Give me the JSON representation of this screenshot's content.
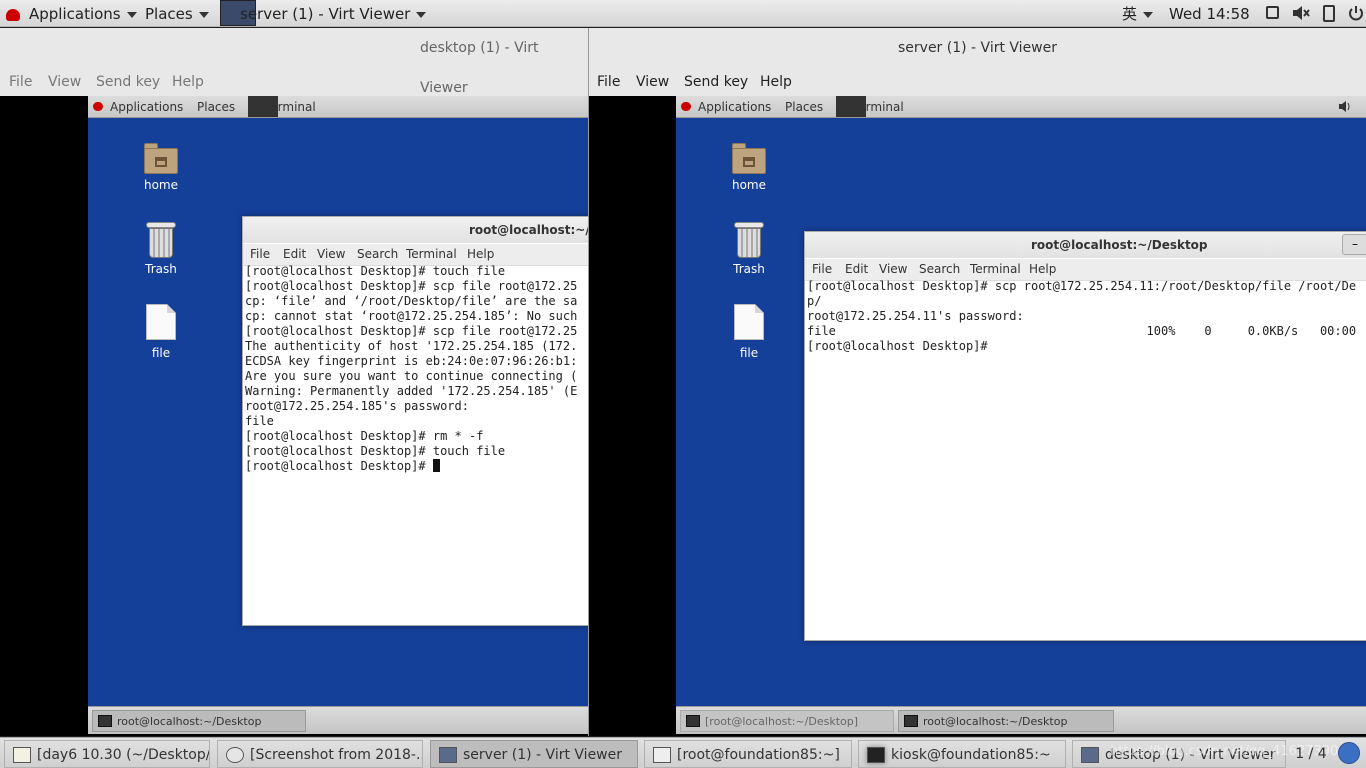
{
  "top_panel": {
    "applications": "Applications",
    "places": "Places",
    "active_window": "server (1) - Virt Viewer",
    "input_method": "英",
    "clock": "Wed 14:58"
  },
  "left_window": {
    "title": "desktop (1) - Virt Viewer",
    "menu": [
      "File",
      "View",
      "Send key",
      "Help"
    ],
    "guest": {
      "panel": {
        "applications": "Applications",
        "places": "Places",
        "terminal": "Terminal"
      },
      "icons": {
        "home": "home",
        "trash": "Trash",
        "file": "file"
      },
      "terminal": {
        "title": "root@localhost:~/D",
        "menu": [
          "File",
          "Edit",
          "View",
          "Search",
          "Terminal",
          "Help"
        ],
        "lines": [
          "[root@localhost Desktop]# touch file",
          "[root@localhost Desktop]# scp file root@172.25",
          "cp: ‘file’ and ‘/root/Desktop/file’ are the sa",
          "cp: cannot stat ‘root@172.25.254.185’: No such",
          "[root@localhost Desktop]# scp file root@172.25",
          "The authenticity of host '172.25.254.185 (172.",
          "ECDSA key fingerprint is eb:24:0e:07:96:26:b1:",
          "Are you sure you want to continue connecting (",
          "Warning: Permanently added '172.25.254.185' (E",
          "root@172.25.254.185's password:",
          "file",
          "[root@localhost Desktop]# rm * -f",
          "[root@localhost Desktop]# touch file"
        ],
        "prompt": "[root@localhost Desktop]# "
      },
      "taskbar": [
        "root@localhost:~/Desktop"
      ]
    }
  },
  "right_window": {
    "title": "server (1) - Virt Viewer",
    "menu": [
      "File",
      "View",
      "Send key",
      "Help"
    ],
    "guest": {
      "panel": {
        "applications": "Applications",
        "places": "Places",
        "terminal": "Terminal"
      },
      "icons": {
        "home": "home",
        "trash": "Trash",
        "file": "file"
      },
      "terminal": {
        "title": "root@localhost:~/Desktop",
        "minimize": "–",
        "menu": [
          "File",
          "Edit",
          "View",
          "Search",
          "Terminal",
          "Help"
        ],
        "lines": [
          "[root@localhost Desktop]# scp root@172.25.254.11:/root/Desktop/file /root/De",
          "p/",
          "root@172.25.254.11's password:",
          "file                                           100%    0     0.0KB/s   00:00",
          "[root@localhost Desktop]#"
        ]
      },
      "taskbar": [
        "[root@localhost:~/Desktop]",
        "root@localhost:~/Desktop"
      ]
    }
  },
  "host_taskbar": {
    "items": [
      "[day6 10.30 (~/Desktop/...",
      "[Screenshot from 2018-...",
      "server (1) - Virt Viewer",
      "[root@foundation85:~]",
      "kiosk@foundation85:~",
      "desktop (1) - Virt Viewer"
    ],
    "workspace": "1 / 4",
    "watermark": "https://blog.csdn.net/qq_41627390"
  }
}
